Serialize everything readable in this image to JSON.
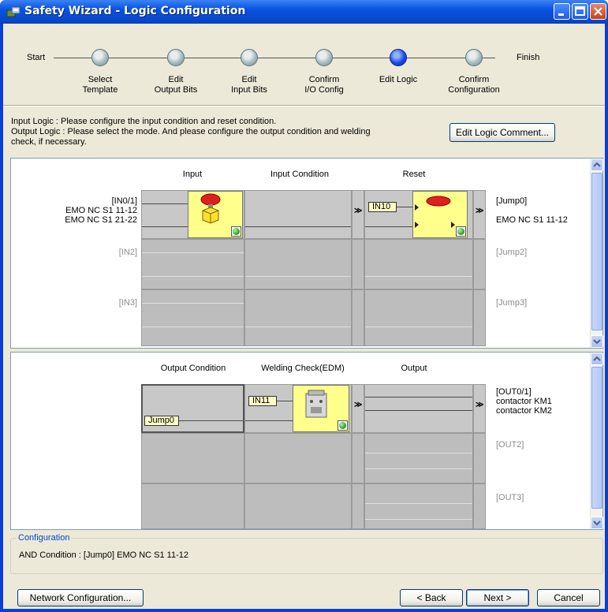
{
  "window": {
    "title": "Safety Wizard - Logic Configuration",
    "icon": "safety-wizard-icon"
  },
  "steps": {
    "start": "Start",
    "finish": "Finish",
    "items": [
      {
        "label": "Select\nTemplate",
        "active": false
      },
      {
        "label": "Edit\nOutput Bits",
        "active": false
      },
      {
        "label": "Edit\nInput Bits",
        "active": false
      },
      {
        "label": "Confirm\nI/O Config",
        "active": false
      },
      {
        "label": "Edit Logic",
        "active": true
      },
      {
        "label": "Confirm\nConfiguration",
        "active": false
      }
    ]
  },
  "description": {
    "line1": "Input Logic : Please configure the input condition and reset condition.",
    "line2": "Output Logic : Please select the mode. And please configure the output condition and welding",
    "line3": "check, if necessary."
  },
  "edit_comment_button": "Edit Logic Comment...",
  "input_panel": {
    "headers": {
      "input": "Input",
      "condition": "Input Condition",
      "reset": "Reset"
    },
    "rows": [
      {
        "left": [
          "[IN0/1]",
          "EMO NC S1 11-12",
          "EMO NC S1 21-22"
        ],
        "right": [
          "[Jump0]",
          "",
          "EMO NC S1 11-12"
        ],
        "reset_tag": "IN10"
      },
      {
        "left": [
          "[IN2]"
        ],
        "right": [
          "[Jump2]"
        ]
      },
      {
        "left": [
          "[IN3]"
        ],
        "right": [
          "[Jump3]"
        ]
      }
    ]
  },
  "output_panel": {
    "headers": {
      "condition": "Output Condition",
      "edm": "Welding Check(EDM)",
      "output": "Output"
    },
    "rows": [
      {
        "condition_tag": "Jump0",
        "edm_tag": "IN11",
        "right": [
          "[OUT0/1]",
          "contactor KM1",
          "contactor KM2"
        ]
      },
      {
        "right": [
          "[OUT2]"
        ]
      },
      {
        "right": [
          "[OUT3]"
        ]
      }
    ]
  },
  "configuration": {
    "title": "Configuration",
    "text": "AND Condition : [Jump0] EMO NC S1 11-12"
  },
  "buttons": {
    "network": "Network Configuration...",
    "back": "< Back",
    "next": "Next >",
    "cancel": "Cancel"
  },
  "colors": {
    "titlebar": "#0a52e0",
    "dialog_bg": "#ece9d8",
    "cell_gray": "#c8c8c8",
    "function_yellow": "#ffff8c",
    "active_step": "#1a4ae8"
  }
}
